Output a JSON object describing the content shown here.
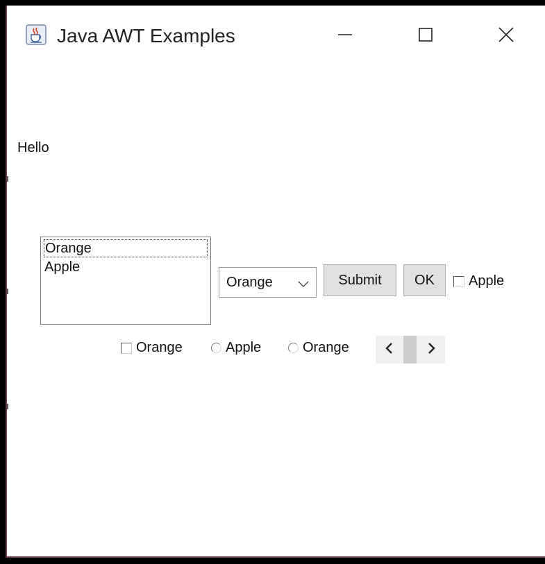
{
  "window": {
    "title": "Java AWT Examples",
    "icon": "java-coffee-cup-icon",
    "controls": [
      "minimize-icon",
      "maximize-icon",
      "close-icon"
    ]
  },
  "label": {
    "text": "Hello"
  },
  "list": {
    "items": [
      "Orange",
      "Apple"
    ],
    "selected": "Orange"
  },
  "choice": {
    "value": "Orange"
  },
  "buttons": {
    "submit": "Submit",
    "ok": "OK"
  },
  "checkboxes": {
    "apple": "Apple",
    "orange": "Orange"
  },
  "radios": {
    "apple": "Apple",
    "orange": "Orange"
  },
  "scrollbar": {
    "left_icon": "chevron-left-icon",
    "right_icon": "chevron-right-icon"
  },
  "colors": {
    "window_bg": "#ffffff",
    "frame_border": "#6b3f49",
    "button_bg": "#e1e1e1",
    "scroll_track": "#f0f0f0",
    "scroll_thumb": "#cdcdcd"
  }
}
